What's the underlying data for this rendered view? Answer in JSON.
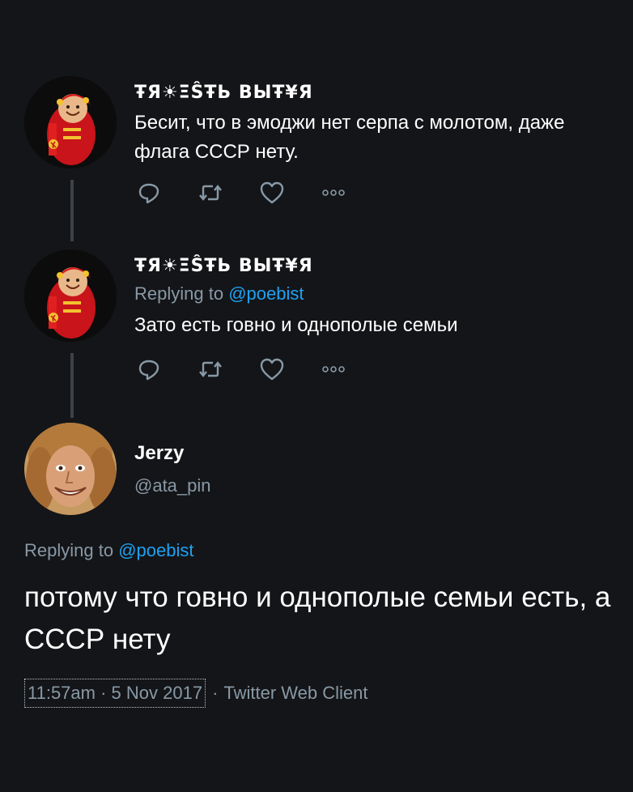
{
  "tweets": [
    {
      "author_name": "ŦЯ☀ΞŜŦЬ ВЫŦ¥Я",
      "reply_prefix": "",
      "reply_mention": "",
      "text": "Бесит, что в эмоджи нет серпа с молотом, даже флага СССР нету.",
      "actions": [
        "reply-icon",
        "retweet-icon",
        "like-icon",
        "more-icon"
      ]
    },
    {
      "author_name": "ŦЯ☀ΞŜŦЬ ВЫŦ¥Я",
      "reply_prefix": "Replying to ",
      "reply_mention": "@poebist",
      "text": "Зато есть говно и однополые семьи",
      "actions": [
        "reply-icon",
        "retweet-icon",
        "like-icon",
        "more-icon"
      ]
    }
  ],
  "main_tweet": {
    "author_name": "Jerzy",
    "handle": "@ata_pin",
    "reply_prefix": "Replying to ",
    "reply_mention": "@poebist",
    "text": "потому что говно и однополые семьи есть, а СССР нету",
    "timestamp": "11:57am · 5 Nov 2017",
    "separator": "·",
    "client": "Twitter Web Client"
  },
  "colors": {
    "background": "#141518",
    "muted": "#8899a6",
    "link": "#1da1f2",
    "thread_line": "#3d4148",
    "icon": "#8899a6"
  }
}
